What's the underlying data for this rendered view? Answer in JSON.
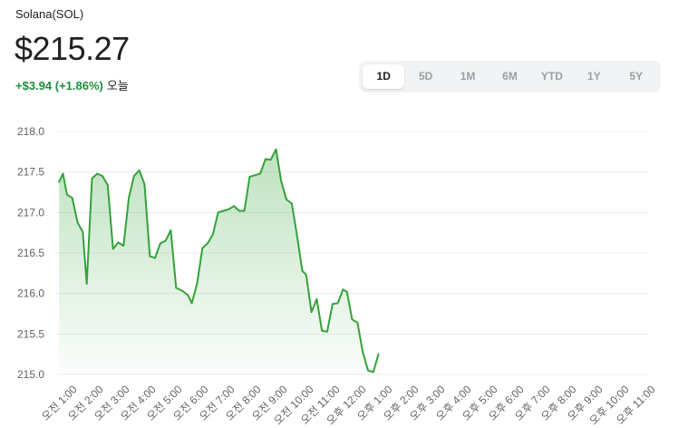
{
  "asset": {
    "name": "Solana(SOL)",
    "price": "$215.27",
    "change": "+$3.94 (+1.86%)",
    "period": "오늘"
  },
  "range_tabs": [
    {
      "label": "1D",
      "active": true
    },
    {
      "label": "5D",
      "active": false
    },
    {
      "label": "1M",
      "active": false
    },
    {
      "label": "6M",
      "active": false
    },
    {
      "label": "YTD",
      "active": false
    },
    {
      "label": "1Y",
      "active": false
    },
    {
      "label": "5Y",
      "active": false
    }
  ],
  "colors": {
    "line": "#34a23a",
    "grid": "#ececec",
    "axis_text": "#5f6368",
    "up": "#1e8e3e"
  },
  "chart_data": {
    "type": "area",
    "ylim": [
      215.0,
      218.0
    ],
    "y_ticks": [
      "218.0",
      "217.5",
      "217.0",
      "216.5",
      "216.0",
      "215.5",
      "215.0"
    ],
    "x_ticks": [
      "오전 1:00",
      "오전 2:00",
      "오전 3:00",
      "오전 4:00",
      "오전 5:00",
      "오전 6:00",
      "오전 7:00",
      "오전 8:00",
      "오전 9:00",
      "오전 10:00",
      "오전 11:00",
      "오후 12:00",
      "오후 1:00",
      "오후 2:00",
      "오후 3:00",
      "오후 4:00",
      "오후 5:00",
      "오후 6:00",
      "오후 7:00",
      "오후 8:00",
      "오후 9:00",
      "오후 10:00",
      "오후 11:00"
    ],
    "x_hours": [
      0,
      24
    ],
    "series": [
      {
        "points": [
          [
            0.3,
            217.38
          ],
          [
            0.45,
            217.48
          ],
          [
            0.6,
            217.22
          ],
          [
            0.8,
            217.18
          ],
          [
            1.0,
            216.88
          ],
          [
            1.2,
            216.76
          ],
          [
            1.35,
            216.12
          ],
          [
            1.55,
            217.42
          ],
          [
            1.75,
            217.48
          ],
          [
            1.95,
            217.45
          ],
          [
            2.15,
            217.34
          ],
          [
            2.35,
            216.55
          ],
          [
            2.55,
            216.63
          ],
          [
            2.75,
            216.59
          ],
          [
            2.95,
            217.18
          ],
          [
            3.15,
            217.45
          ],
          [
            3.35,
            217.52
          ],
          [
            3.55,
            217.35
          ],
          [
            3.75,
            216.46
          ],
          [
            3.95,
            216.44
          ],
          [
            4.15,
            216.62
          ],
          [
            4.35,
            216.65
          ],
          [
            4.55,
            216.78
          ],
          [
            4.75,
            216.07
          ],
          [
            5.0,
            216.03
          ],
          [
            5.2,
            215.98
          ],
          [
            5.35,
            215.88
          ],
          [
            5.55,
            216.12
          ],
          [
            5.75,
            216.56
          ],
          [
            5.95,
            216.62
          ],
          [
            6.15,
            216.73
          ],
          [
            6.35,
            217.0
          ],
          [
            6.55,
            217.02
          ],
          [
            6.75,
            217.04
          ],
          [
            6.95,
            217.08
          ],
          [
            7.15,
            217.02
          ],
          [
            7.35,
            217.02
          ],
          [
            7.55,
            217.44
          ],
          [
            7.75,
            217.46
          ],
          [
            7.95,
            217.48
          ],
          [
            8.15,
            217.66
          ],
          [
            8.35,
            217.65
          ],
          [
            8.55,
            217.78
          ],
          [
            8.75,
            217.38
          ],
          [
            8.95,
            217.16
          ],
          [
            9.15,
            217.11
          ],
          [
            9.35,
            216.72
          ],
          [
            9.55,
            216.28
          ],
          [
            9.7,
            216.23
          ],
          [
            9.9,
            215.77
          ],
          [
            10.1,
            215.93
          ],
          [
            10.3,
            215.54
          ],
          [
            10.5,
            215.53
          ],
          [
            10.7,
            215.87
          ],
          [
            10.9,
            215.88
          ],
          [
            11.1,
            216.05
          ],
          [
            11.25,
            216.02
          ],
          [
            11.45,
            215.68
          ],
          [
            11.65,
            215.64
          ],
          [
            11.85,
            215.28
          ],
          [
            12.05,
            215.05
          ],
          [
            12.25,
            215.03
          ],
          [
            12.45,
            215.25
          ]
        ]
      }
    ]
  }
}
